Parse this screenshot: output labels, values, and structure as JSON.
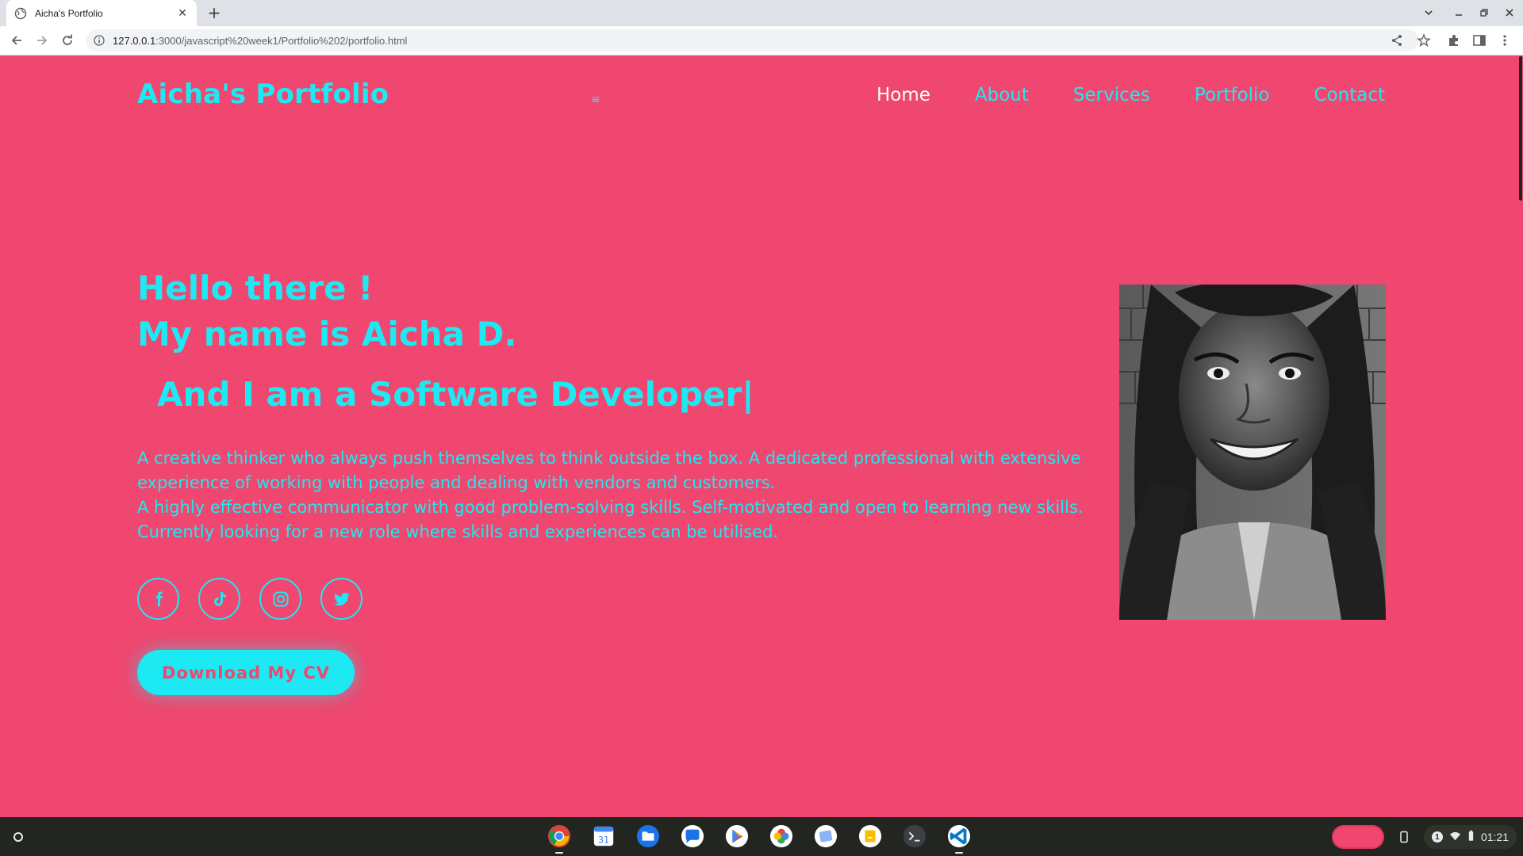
{
  "browser": {
    "tab_title": "Aicha's Portfolio",
    "tab_close": "✕",
    "new_tab": "+",
    "url_host": "127.0.0.1",
    "url_path": ":3000/javascript%20week1/Portfolio%202/portfolio.html"
  },
  "site": {
    "logo": "Aicha's Portfolio",
    "menu_icon": "≡",
    "nav": [
      "Home",
      "About",
      "Services",
      "Portfolio",
      "Contact"
    ],
    "active_nav": "Home",
    "greeting_line1": "Hello there !",
    "greeting_line2": "My name is Aicha D.",
    "typed_text": "And I am a Software Developer",
    "typed_cursor": "|",
    "bio": [
      "A creative thinker who always push themselves to think outside the box. A dedicated professional with extensive experience of working with people and dealing with vendors and customers.",
      "A highly effective communicator with good problem-solving skills. Self-motivated and open to learning new skills. Currently looking for a new role where skills and experiences can be utilised."
    ],
    "socials": [
      "facebook-icon",
      "tiktok-icon",
      "instagram-icon",
      "twitter-icon"
    ],
    "cv_button": "Download My CV"
  },
  "shelf": {
    "apps": [
      "chrome",
      "calendar",
      "files",
      "messages",
      "play-store",
      "photos",
      "gallery",
      "keep",
      "terminal",
      "vscode"
    ],
    "notification_count": "1",
    "time": "01:21"
  },
  "colors": {
    "background": "#ef476f",
    "accent": "#1de9f2",
    "active_nav": "#ffffff"
  }
}
